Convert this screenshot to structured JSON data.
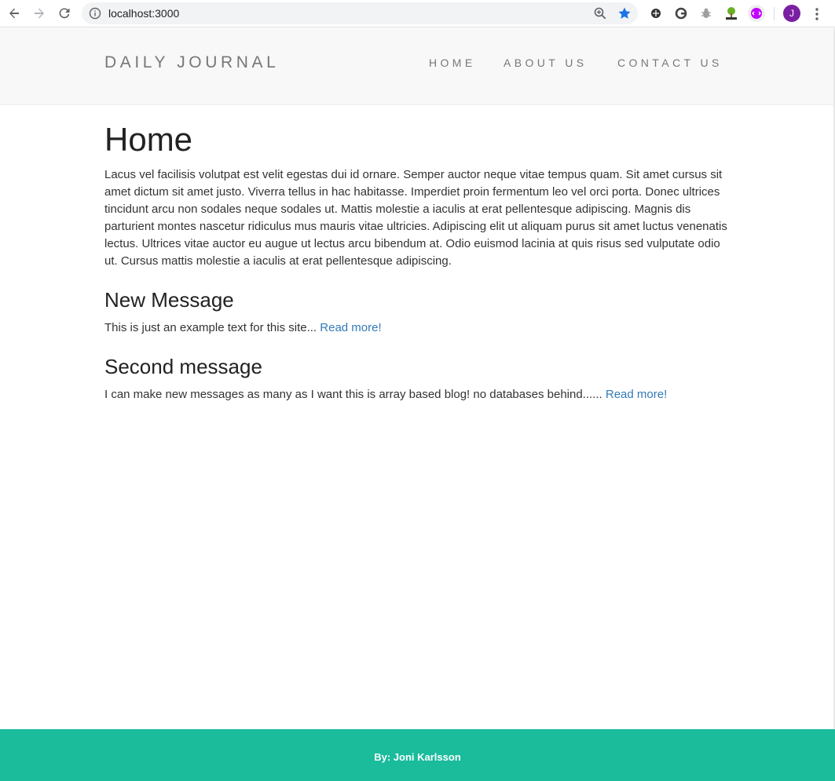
{
  "browser": {
    "url": "localhost:3000",
    "avatar_initial": "J",
    "icons": {
      "back": "arrow-left-icon",
      "forward": "arrow-right-icon",
      "reload": "reload-icon",
      "info": "info-icon",
      "zoom": "zoom-in-icon",
      "bookmark": "star-icon",
      "menu": "kebab-menu-icon"
    },
    "accent_color": "#1a73e8"
  },
  "header": {
    "brand": "DAILY JOURNAL",
    "nav": [
      {
        "label": "HOME"
      },
      {
        "label": "ABOUT US"
      },
      {
        "label": "CONTACT US"
      }
    ]
  },
  "main": {
    "title": "Home",
    "intro": "Lacus vel facilisis volutpat est velit egestas dui id ornare. Semper auctor neque vitae tempus quam. Sit amet cursus sit amet dictum sit amet justo. Viverra tellus in hac habitasse. Imperdiet proin fermentum leo vel orci porta. Donec ultrices tincidunt arcu non sodales neque sodales ut. Mattis molestie a iaculis at erat pellentesque adipiscing. Magnis dis parturient montes nascetur ridiculus mus mauris vitae ultricies. Adipiscing elit ut aliquam purus sit amet luctus venenatis lectus. Ultrices vitae auctor eu augue ut lectus arcu bibendum at. Odio euismod lacinia at quis risus sed vulputate odio ut. Cursus mattis molestie a iaculis at erat pellentesque adipiscing.",
    "posts": [
      {
        "title": "New Message",
        "excerpt": "This is just an example text for this site...",
        "link_label": "Read more",
        "suffix": "!"
      },
      {
        "title": "Second message",
        "excerpt": "I can make new messages as many as I want this is array based blog! no databases behind......",
        "link_label": "Read more",
        "suffix": "!"
      }
    ]
  },
  "footer": {
    "text": "By: Joni Karlsson",
    "color": "#1abc9c"
  },
  "colors": {
    "link": "#337ab7",
    "header_bg": "#f8f8f8"
  }
}
